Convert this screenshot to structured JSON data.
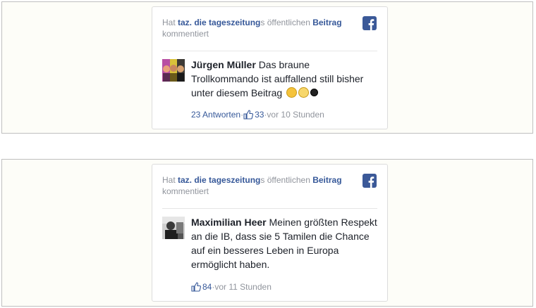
{
  "posts": [
    {
      "header": {
        "prefix": "Hat ",
        "page": "taz. die tageszeitung",
        "middle": "s öffentlichen ",
        "post_link": "Beitrag",
        "suffix": "kommentiert"
      },
      "author": "Jürgen Müller",
      "comment": "Das braune Trollkommando ist auffallend still bisher unter diesem Beitrag",
      "emojis": [
        "grinning-sweat-emoji",
        "thinking-emoji",
        "smiley-emoji"
      ],
      "replies": "23 Antworten",
      "likes": "33",
      "time": "vor 10 Stunden"
    },
    {
      "header": {
        "prefix": "Hat ",
        "page": "taz. die tageszeitung",
        "middle": "s öffentlichen ",
        "post_link": "Beitrag",
        "suffix": "kommentiert"
      },
      "author": "Maximilian Heer",
      "comment": "Meinen größten Respekt an die IB, dass sie 5 Tamilen die Chance auf ein besseres Leben in Europa ermöglicht haben.",
      "likes": "84",
      "time": "vor 11 Stunden"
    }
  ],
  "separator": " · ",
  "colors": {
    "link": "#365899",
    "meta": "#90949c",
    "facebook": "#3b5998"
  }
}
